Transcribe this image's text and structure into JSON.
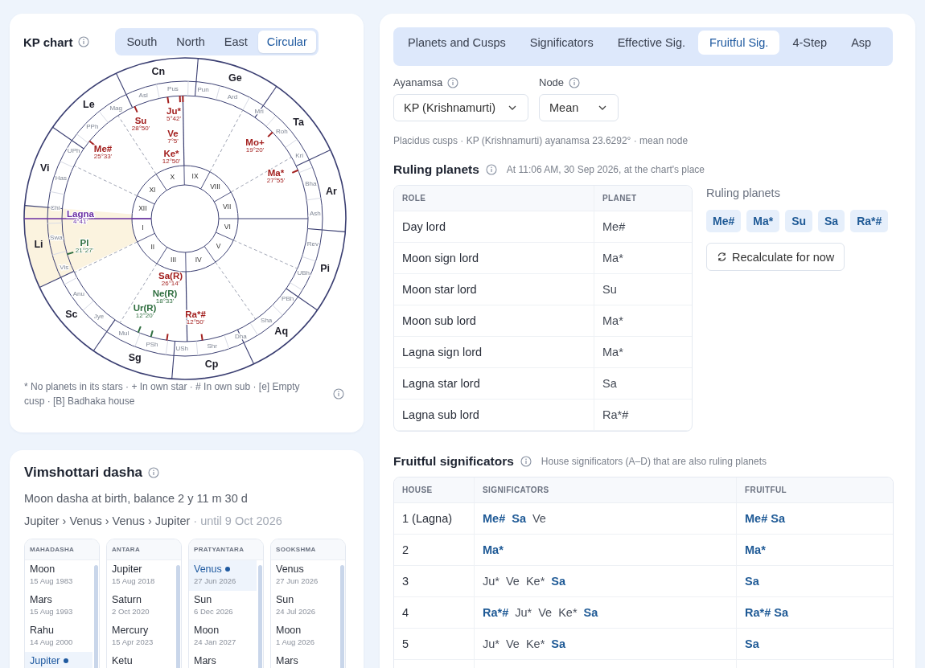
{
  "chart_panel": {
    "title": "KP chart",
    "styles": [
      {
        "label": "South",
        "selected": false
      },
      {
        "label": "North",
        "selected": false
      },
      {
        "label": "East",
        "selected": false
      },
      {
        "label": "Circular",
        "selected": true
      }
    ],
    "signs": [
      {
        "label": "Ar",
        "highlighted": false
      },
      {
        "label": "Ta",
        "highlighted": false
      },
      {
        "label": "Ge",
        "highlighted": false
      },
      {
        "label": "Cn",
        "highlighted": false
      },
      {
        "label": "Le",
        "highlighted": false
      },
      {
        "label": "Vi",
        "highlighted": false
      },
      {
        "label": "Li",
        "highlighted": true
      },
      {
        "label": "Sc",
        "highlighted": false
      },
      {
        "label": "Sg",
        "highlighted": false
      },
      {
        "label": "Cp",
        "highlighted": false
      },
      {
        "label": "Aq",
        "highlighted": false
      },
      {
        "label": "Pi",
        "highlighted": false
      }
    ],
    "nakshatras": [
      "Ash",
      "Bha",
      "Kri",
      "Roh",
      "Mri",
      "Ard",
      "Pun",
      "Pus",
      "Asl",
      "Mag",
      "PPh",
      "UPh",
      "Has",
      "Chi",
      "Swa",
      "Vis",
      "Anu",
      "Jye",
      "Mul",
      "PSh",
      "USh",
      "Shr",
      "Dha",
      "Sha",
      "PBh",
      "UBh",
      "Rev"
    ],
    "houses": [
      "I",
      "II",
      "III",
      "IV",
      "V",
      "VI",
      "VII",
      "VIII",
      "IX",
      "X",
      "XI",
      "XII"
    ],
    "planets": [
      {
        "label": "Lagna",
        "degree": "4°41'",
        "color": "#6b2fa3"
      },
      {
        "label": "Su",
        "degree": "28°50'",
        "color": "#a3201f"
      },
      {
        "label": "Ju*",
        "degree": "5°42'",
        "color": "#a3201f"
      },
      {
        "label": "Ve",
        "degree": "7°5'",
        "color": "#a3201f"
      },
      {
        "label": "Ke*",
        "degree": "12°50'",
        "color": "#a3201f"
      },
      {
        "label": "Me#",
        "degree": "25°33'",
        "color": "#a3201f"
      },
      {
        "label": "Mo+",
        "degree": "19°20'",
        "color": "#a3201f"
      },
      {
        "label": "Ma*",
        "degree": "27°55'",
        "color": "#a3201f"
      },
      {
        "label": "Pl",
        "degree": "21°27'",
        "color": "#2f6e3f"
      },
      {
        "label": "Sa(R)",
        "degree": "26°14'",
        "color": "#a3201f"
      },
      {
        "label": "Ne(R)",
        "degree": "18°33'",
        "color": "#2f6e3f"
      },
      {
        "label": "Ur(R)",
        "degree": "12°20'",
        "color": "#2f6e3f"
      },
      {
        "label": "Ra*#",
        "degree": "12°50'",
        "color": "#a3201f"
      }
    ],
    "legend": "* No planets in its stars · + In own star · # In own sub · [e] Empty cusp · [B] Badhaka house"
  },
  "dasha": {
    "title": "Vimshottari dasha",
    "balance": "Moon dasha at birth, balance 2 y 11 m 30 d",
    "path": "Jupiter › Venus › Venus › Jupiter",
    "until": " · until 9 Oct 2026",
    "columns": [
      {
        "title": "MAHADASHA",
        "entries": [
          {
            "name": "Moon",
            "date": "15 Aug 1983",
            "selected": false
          },
          {
            "name": "Mars",
            "date": "15 Aug 1993",
            "selected": false
          },
          {
            "name": "Rahu",
            "date": "14 Aug 2000",
            "selected": false
          },
          {
            "name": "Jupiter",
            "selected": true
          }
        ]
      },
      {
        "title": "ANTARA",
        "entries": [
          {
            "name": "Jupiter",
            "date": "15 Aug 2018",
            "selected": false
          },
          {
            "name": "Saturn",
            "date": "2 Oct 2020",
            "selected": false
          },
          {
            "name": "Mercury",
            "date": "15 Apr 2023",
            "selected": false
          },
          {
            "name": "Ketu",
            "selected": false
          }
        ]
      },
      {
        "title": "PRATYANTARA",
        "entries": [
          {
            "name": "Venus",
            "date": "27 Jun 2026",
            "selected": true
          },
          {
            "name": "Sun",
            "date": "6 Dec 2026",
            "selected": false
          },
          {
            "name": "Moon",
            "date": "24 Jan 2027",
            "selected": false
          },
          {
            "name": "Mars",
            "selected": false
          }
        ]
      },
      {
        "title": "SOOKSHMA",
        "entries": [
          {
            "name": "Venus",
            "date": "27 Jun 2026",
            "selected": false
          },
          {
            "name": "Sun",
            "date": "24 Jul 2026",
            "selected": false
          },
          {
            "name": "Moon",
            "date": "1 Aug 2026",
            "selected": false
          },
          {
            "name": "Mars",
            "selected": false
          }
        ]
      }
    ]
  },
  "tabs": [
    {
      "label": "Planets and Cusps",
      "selected": false
    },
    {
      "label": "Significators",
      "selected": false
    },
    {
      "label": "Effective Sig.",
      "selected": false
    },
    {
      "label": "Fruitful Sig.",
      "selected": true
    },
    {
      "label": "4-Step",
      "selected": false
    },
    {
      "label": "Asp",
      "selected": false
    }
  ],
  "ayanamsa": {
    "label": "Ayanamsa",
    "value": "KP (Krishnamurti)"
  },
  "node": {
    "label": "Node",
    "value": "Mean"
  },
  "caption": "Placidus cusps · KP (Krishnamurti) ayanamsa 23.6292° · mean node",
  "ruling": {
    "title": "Ruling planets",
    "time": "At 11:06 AM, 30 Sep 2026, at the chart's place",
    "columns": [
      "ROLE",
      "PLANET"
    ],
    "rows": [
      {
        "role": "Day lord",
        "planet": "Me#"
      },
      {
        "role": "Moon sign lord",
        "planet": "Ma*"
      },
      {
        "role": "Moon star lord",
        "planet": "Su"
      },
      {
        "role": "Moon sub lord",
        "planet": "Ma*"
      },
      {
        "role": "Lagna sign lord",
        "planet": "Ma*"
      },
      {
        "role": "Lagna star lord",
        "planet": "Sa"
      },
      {
        "role": "Lagna sub lord",
        "planet": "Ra*#"
      }
    ],
    "side_label": "Ruling planets",
    "chips": [
      "Me#",
      "Ma*",
      "Su",
      "Sa",
      "Ra*#"
    ],
    "button": "Recalculate for now"
  },
  "fruitful": {
    "title": "Fruitful significators",
    "subtitle": "House significators (A–D) that are also ruling planets",
    "columns": [
      "HOUSE",
      "SIGNIFICATORS",
      "FRUITFUL"
    ],
    "rows": [
      {
        "house": "1 (Lagna)",
        "significators": [
          {
            "label": "Me#",
            "fruitful": true
          },
          {
            "label": "Sa",
            "fruitful": true
          },
          {
            "label": "Ve",
            "fruitful": false
          }
        ],
        "fruitful": "Me# Sa"
      },
      {
        "house": "2",
        "significators": [
          {
            "label": "Ma*",
            "fruitful": true
          }
        ],
        "fruitful": "Ma*"
      },
      {
        "house": "3",
        "significators": [
          {
            "label": "Ju*",
            "fruitful": false
          },
          {
            "label": "Ve",
            "fruitful": false
          },
          {
            "label": "Ke*",
            "fruitful": false
          },
          {
            "label": "Sa",
            "fruitful": true
          }
        ],
        "fruitful": "Sa"
      },
      {
        "house": "4",
        "significators": [
          {
            "label": "Ra*#",
            "fruitful": true
          },
          {
            "label": "Ju*",
            "fruitful": false
          },
          {
            "label": "Ve",
            "fruitful": false
          },
          {
            "label": "Ke*",
            "fruitful": false
          },
          {
            "label": "Sa",
            "fruitful": true
          }
        ],
        "fruitful": "Ra*# Sa"
      },
      {
        "house": "5",
        "significators": [
          {
            "label": "Ju*",
            "fruitful": false
          },
          {
            "label": "Ve",
            "fruitful": false
          },
          {
            "label": "Ke*",
            "fruitful": false
          },
          {
            "label": "Sa",
            "fruitful": true
          }
        ],
        "fruitful": "Sa"
      }
    ]
  }
}
